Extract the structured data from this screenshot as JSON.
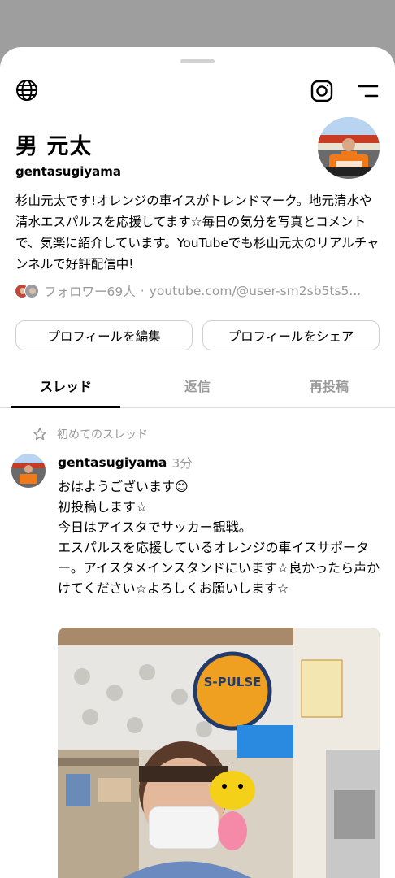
{
  "profile": {
    "display_name": "男 元太",
    "username": "gentasugiyama",
    "bio": "杉山元太です!オレンジの車イスがトレンドマーク。地元清水や清水エスパルスを応援してます☆毎日の気分を写真とコメントで、気楽に紹介しています。YouTubeでも杉山元太のリアルチャンネルで好評配信中!",
    "followers": "フォロワー69人",
    "separator": "·",
    "link": "youtube.com/@user-sm2sb5ts5..."
  },
  "buttons": {
    "edit": "プロフィールを編集",
    "share": "プロフィールをシェア"
  },
  "tabs": [
    {
      "label": "スレッド"
    },
    {
      "label": "返信"
    },
    {
      "label": "再投稿"
    }
  ],
  "pinned": {
    "label": "初めてのスレッド"
  },
  "post": {
    "username": "gentasugiyama",
    "time": "3分",
    "lines": [
      "おはようございます😊",
      "初投稿します☆",
      "今日はアイスタでサッカー観戦。",
      "エスパルスを応援しているオレンジの車イスサポーター。アイスタメインスタンドにいます☆良かったら声かけてください☆よろしくお願いします☆"
    ],
    "badge_text": "S-PULSE"
  },
  "icons": {
    "top_left": "globe-icon",
    "top_right_1": "instagram-icon",
    "top_right_2": "menu-icon",
    "pinned": "star-outline-icon"
  },
  "colors": {
    "sheet_bg": "#ffffff",
    "backdrop": "#9e9e9e",
    "muted_text": "#9a9a9a",
    "accent_orange": "#f07a1a"
  }
}
